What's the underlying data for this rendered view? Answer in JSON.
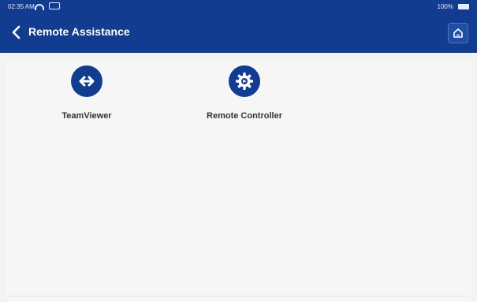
{
  "status_bar": {
    "time": "02:35 AM",
    "battery_percent": "100%"
  },
  "header": {
    "title": "Remote Assistance",
    "back_icon": "chevron-left-icon",
    "home_icon": "home-icon"
  },
  "apps": [
    {
      "label": "TeamViewer",
      "icon": "double-arrow-icon"
    },
    {
      "label": "Remote Controller",
      "icon": "gear-icon"
    }
  ],
  "colors": {
    "header_bg": "#123c8f",
    "icon_bg": "#123c8f",
    "content_bg": "#f3f3f3"
  }
}
